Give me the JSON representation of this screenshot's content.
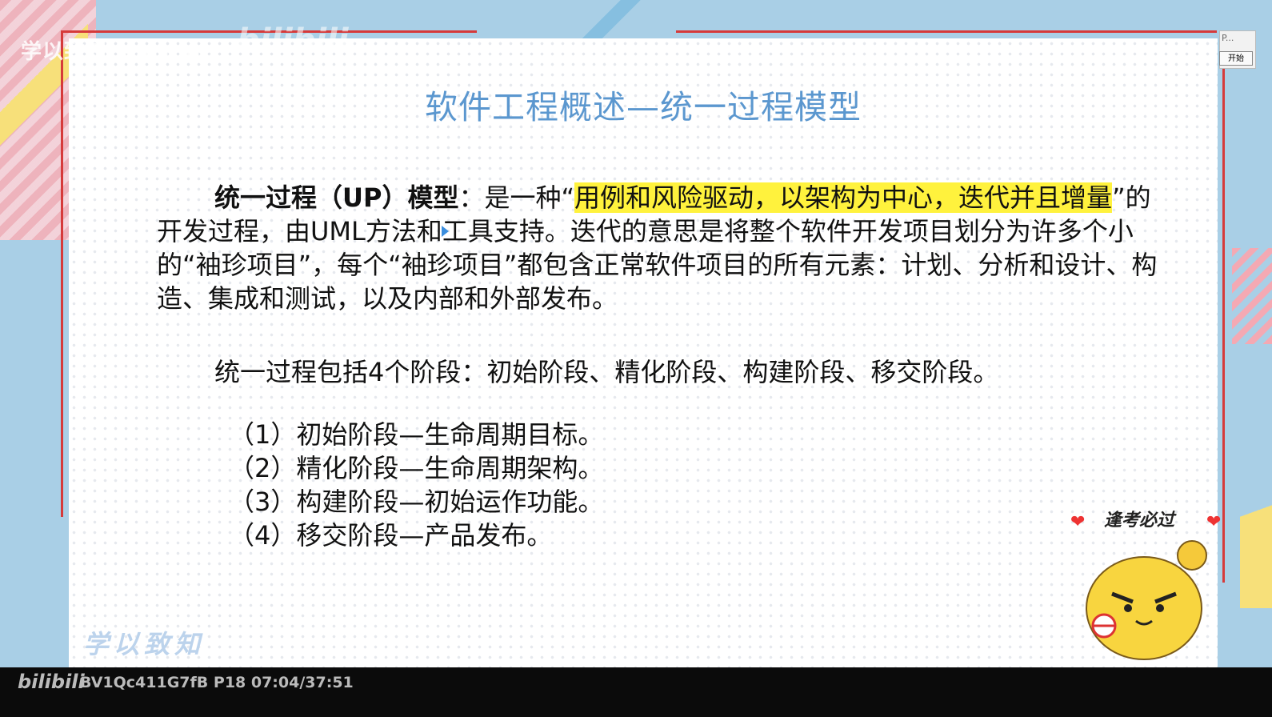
{
  "watermark": {
    "brand": "学以致知Learning",
    "bili_top": "bilibili",
    "motto": "学以致知"
  },
  "slide": {
    "title": "软件工程概述—统一过程模型",
    "intro": {
      "term": "统一过程（UP）模型",
      "lead": "：是一种“",
      "highlight": "用例和风险驱动，以架构为中心，迭代并且增量",
      "rest": "”的开发过程，由UML方法和工具支持。迭代的意思是将整个软件开发项目划分为许多个小的“袖珍项目”，每个“袖珍项目”都包含正常软件项目的所有元素：计划、分析和设计、构造、集成和测试，以及内部和外部发布。"
    },
    "phases_text": "统一过程包括4个阶段：初始阶段、精化阶段、构建阶段、移交阶段。",
    "stages": [
      "（1）初始阶段—生命周期目标。",
      "（2）精化阶段—生命周期架构。",
      "（3）构建阶段—初始运作功能。",
      "（4）移交阶段—产品发布。"
    ]
  },
  "mascot": {
    "caption": "逢考必过"
  },
  "mini_panel": {
    "label": "P...",
    "button": "开始"
  },
  "player": {
    "logo": "bilibili",
    "info": "BV1Qc411G7fB P18 07:04/37:51"
  },
  "colors": {
    "title": "#5b97cf",
    "highlight": "#fff23d",
    "frame": "#d63a3a",
    "background": "#a9cfe6"
  }
}
